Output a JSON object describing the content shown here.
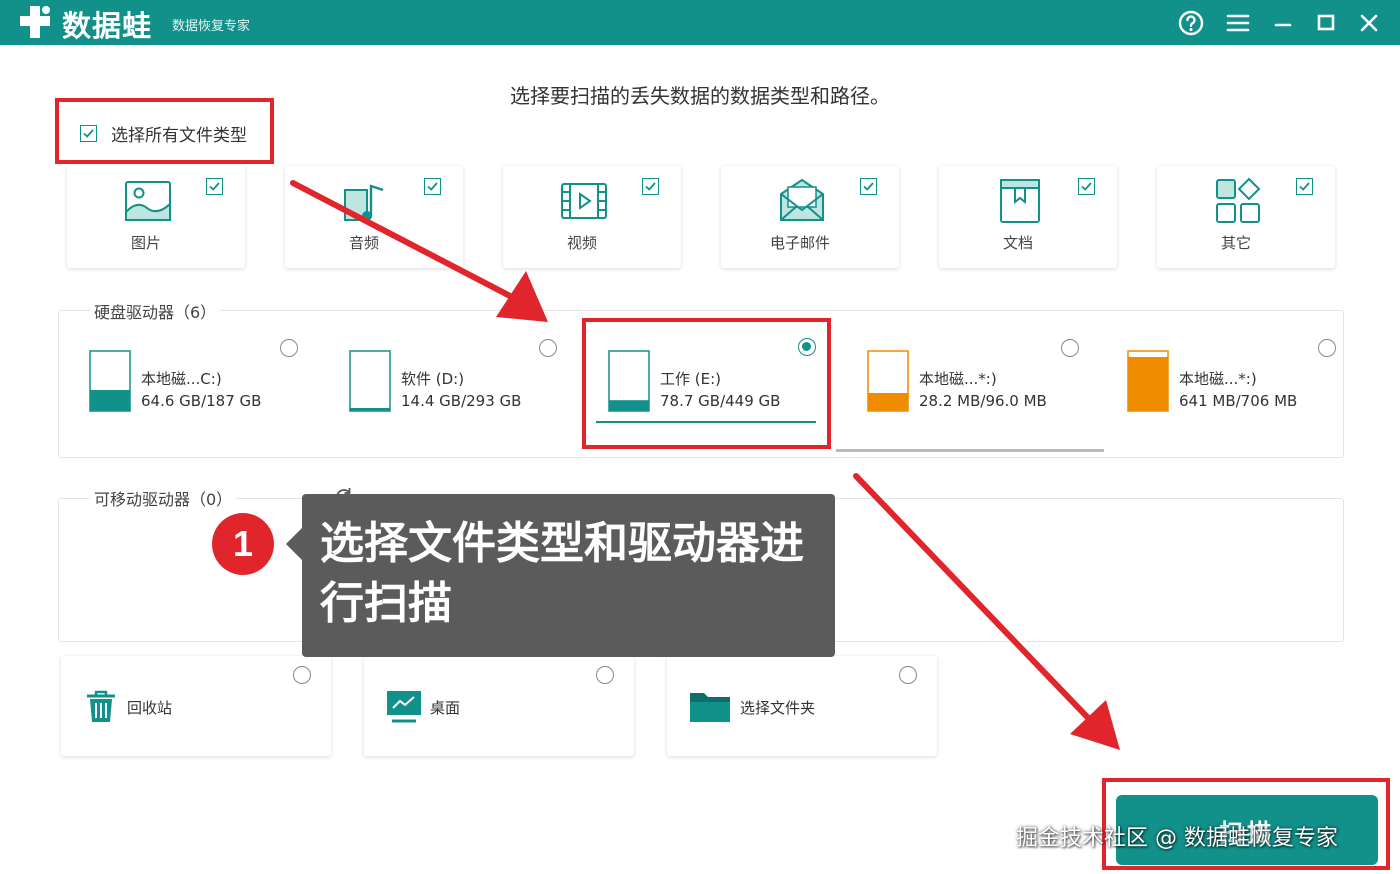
{
  "app": {
    "title": "数据蛙",
    "subtitle": "数据恢复专家"
  },
  "instruction": "选择要扫描的丢失数据的数据类型和路径。",
  "select_all": {
    "label": "选择所有文件类型",
    "checked": true
  },
  "file_types": [
    {
      "label": "图片",
      "icon": "image-icon",
      "checked": true
    },
    {
      "label": "音频",
      "icon": "audio-icon",
      "checked": true
    },
    {
      "label": "视频",
      "icon": "video-icon",
      "checked": true
    },
    {
      "label": "电子邮件",
      "icon": "email-icon",
      "checked": true
    },
    {
      "label": "文档",
      "icon": "document-icon",
      "checked": true
    },
    {
      "label": "其它",
      "icon": "other-icon",
      "checked": true
    }
  ],
  "hard_drives": {
    "title": "硬盘驱动器（6）",
    "items": [
      {
        "name": "本地磁...C:)",
        "size": "64.6 GB/187 GB",
        "fill": 0.35,
        "color": "#12908a",
        "selected": false
      },
      {
        "name": "软件 (D:)",
        "size": "14.4 GB/293 GB",
        "fill": 0.05,
        "color": "#12908a",
        "selected": false
      },
      {
        "name": "工作 (E:)",
        "size": "78.7 GB/449 GB",
        "fill": 0.18,
        "color": "#12908a",
        "selected": true
      },
      {
        "name": "本地磁...*:)",
        "size": "28.2 MB/96.0 MB",
        "fill": 0.3,
        "color": "#f08c00",
        "selected": false
      },
      {
        "name": "本地磁...*:)",
        "size": "641 MB/706 MB",
        "fill": 0.9,
        "color": "#f08c00",
        "selected": false
      }
    ]
  },
  "removable_drives": {
    "title": "可移动驱动器（0）"
  },
  "locations": [
    {
      "label": "回收站",
      "icon": "trash-icon",
      "selected": false
    },
    {
      "label": "桌面",
      "icon": "desktop-icon",
      "selected": false
    },
    {
      "label": "选择文件夹",
      "icon": "folder-icon",
      "selected": false
    }
  ],
  "scan_button": "扫描",
  "callout": {
    "number": "1",
    "text": "选择文件类型和驱动器进行扫描"
  },
  "watermark": "掘金技术社区 @ 数据蛙恢复专家",
  "colors": {
    "accent": "#12908a",
    "annotation": "#e0262c",
    "warning": "#f08c00"
  }
}
